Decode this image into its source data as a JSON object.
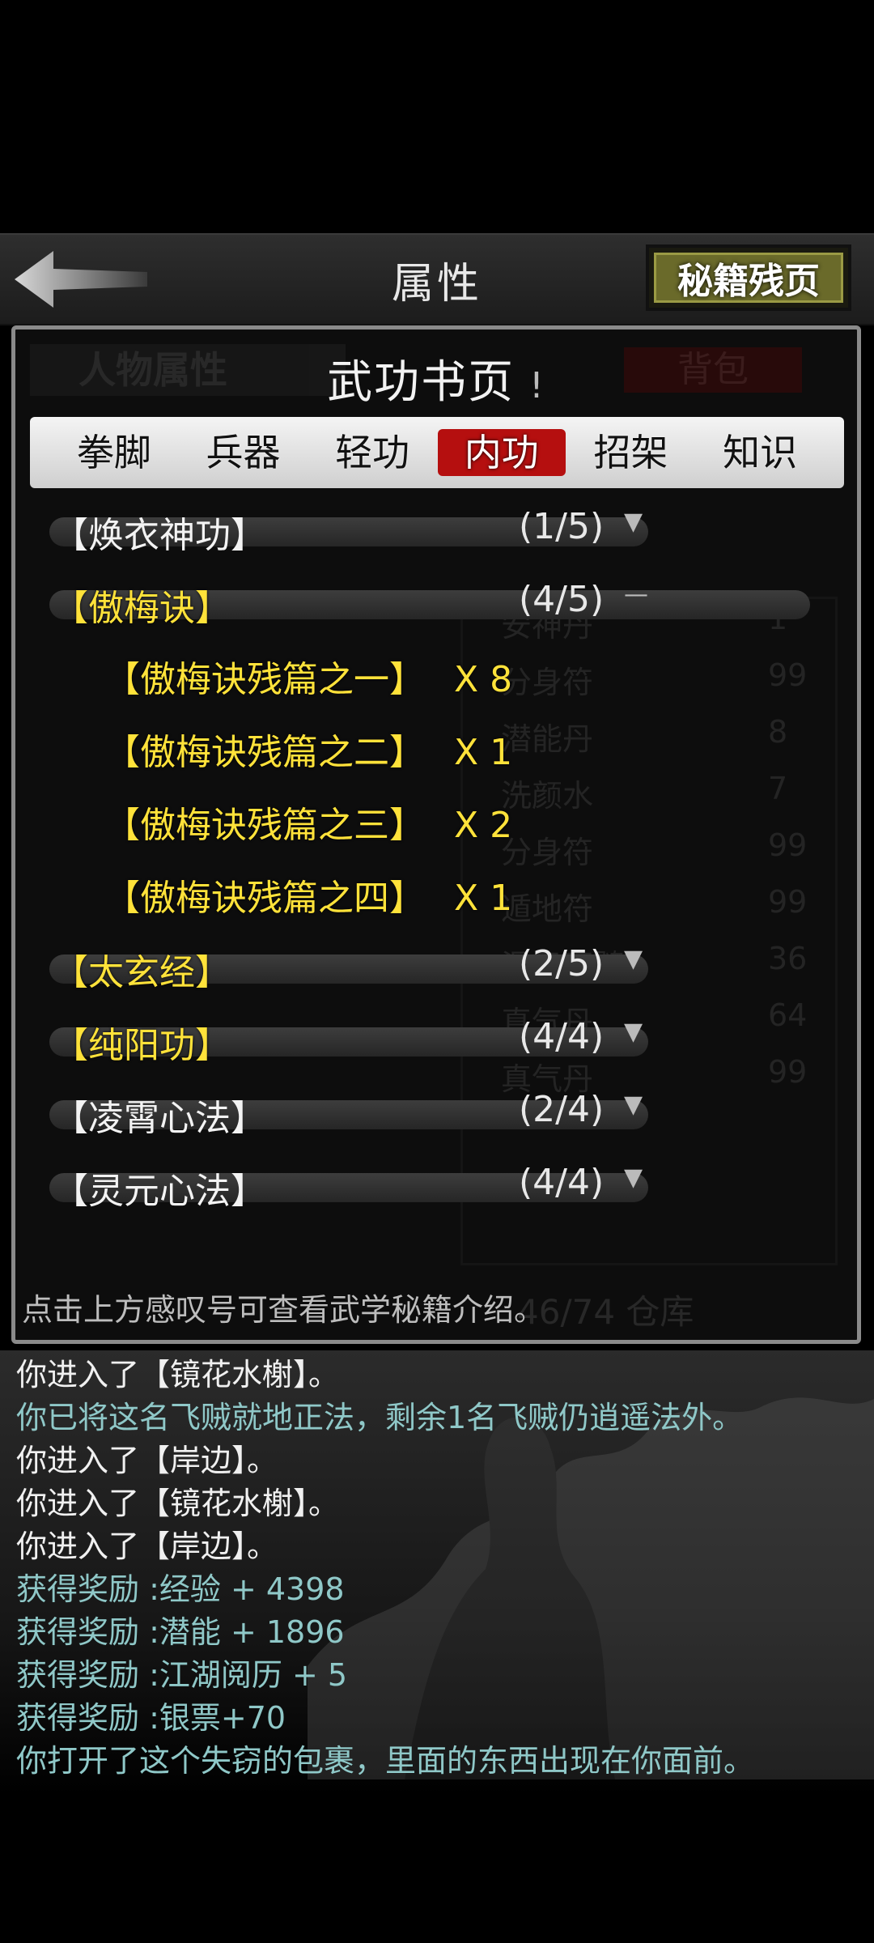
{
  "header": {
    "title": "属性",
    "right_button": "秘籍残页"
  },
  "panel": {
    "title": "武功书页",
    "exclaim": "!",
    "tabs": [
      {
        "label": "拳脚",
        "active": false
      },
      {
        "label": "兵器",
        "active": false
      },
      {
        "label": "轻功",
        "active": false
      },
      {
        "label": "内功",
        "active": true
      },
      {
        "label": "招架",
        "active": false
      },
      {
        "label": "知识",
        "active": false
      }
    ],
    "skills": [
      {
        "name": "【焕衣神功】",
        "count": "(1/5)",
        "toggle": "▼",
        "expanded": false,
        "color": "white"
      },
      {
        "name": "【傲梅诀】",
        "count": "(4/5)",
        "toggle": "—",
        "expanded": true,
        "color": "gold",
        "fragments": [
          {
            "name": "【傲梅诀残篇之一】",
            "qty": "X 8"
          },
          {
            "name": "【傲梅诀残篇之二】",
            "qty": "X 1"
          },
          {
            "name": "【傲梅诀残篇之三】",
            "qty": "X 2"
          },
          {
            "name": "【傲梅诀残篇之四】",
            "qty": "X 1"
          }
        ]
      },
      {
        "name": "【太玄经】",
        "count": "(2/5)",
        "toggle": "▼",
        "expanded": false,
        "color": "gold"
      },
      {
        "name": "【纯阳功】",
        "count": "(4/4)",
        "toggle": "▼",
        "expanded": false,
        "color": "gold"
      },
      {
        "name": "【凌霄心法】",
        "count": "(2/4)",
        "toggle": "▼",
        "expanded": false,
        "color": "white"
      },
      {
        "name": "【灵元心法】",
        "count": "(4/4)",
        "toggle": "▼",
        "expanded": false,
        "color": "white"
      }
    ],
    "hint": "点击上方感叹号可查看武学秘籍介绍。",
    "background": {
      "left_tab": "人物属性",
      "right_tab": "背包",
      "storage_count": "46/74 仓库",
      "items": [
        {
          "name": "安神丹",
          "qty": "1"
        },
        {
          "name": "分身符",
          "qty": "99"
        },
        {
          "name": "潜能丹",
          "qty": "8"
        },
        {
          "name": "洗颜水",
          "qty": "7"
        },
        {
          "name": "分身符",
          "qty": "99"
        },
        {
          "name": "遁地符",
          "qty": "99"
        },
        {
          "name": "混元石髓",
          "qty": "36"
        },
        {
          "name": "真气丹",
          "qty": "64"
        },
        {
          "name": "真气丹",
          "qty": "99"
        }
      ]
    }
  },
  "log": [
    {
      "text": "你进入了【镜花水榭】。",
      "color": "white"
    },
    {
      "text": "你已将这名飞贼就地正法，剩余1名飞贼仍逍遥法外。",
      "color": "teal"
    },
    {
      "text": "你进入了【岸边】。",
      "color": "white"
    },
    {
      "text": "你进入了【镜花水榭】。",
      "color": "white"
    },
    {
      "text": "你进入了【岸边】。",
      "color": "white"
    },
    {
      "text": "获得奖励 :经验 + 4398",
      "color": "teal"
    },
    {
      "text": "获得奖励 :潜能 + 1896",
      "color": "teal"
    },
    {
      "text": "获得奖励 :江湖阅历 + 5",
      "color": "teal"
    },
    {
      "text": "获得奖励 :银票+70",
      "color": "teal"
    },
    {
      "text": "你打开了这个失窃的包裹，里面的东西出现在你面前。",
      "color": "teal"
    }
  ]
}
